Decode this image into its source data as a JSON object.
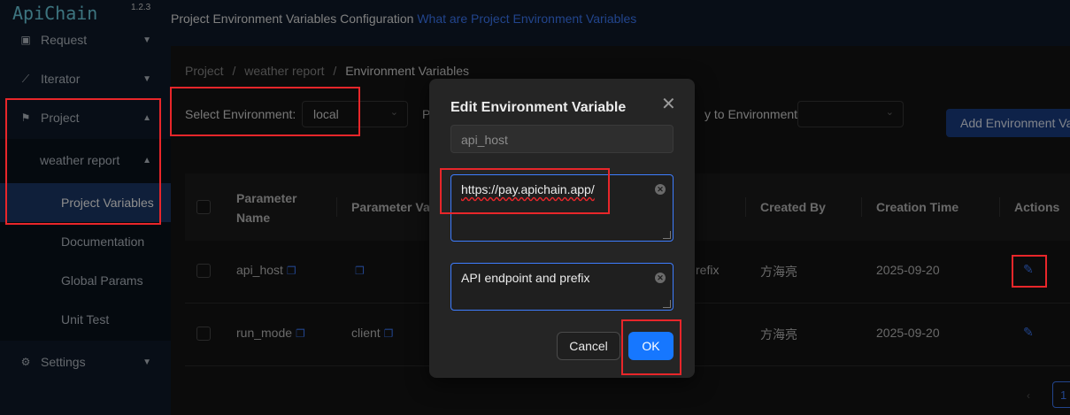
{
  "app": {
    "name": "ApiChain",
    "version": "1.2.3"
  },
  "sidebar": {
    "items": [
      {
        "label": "Request",
        "icon": "request-icon"
      },
      {
        "label": "Iterator",
        "icon": "chart-line-icon"
      },
      {
        "label": "Project",
        "icon": "flag-icon"
      },
      {
        "label": "Settings",
        "icon": "gear-icon"
      }
    ],
    "submenu_title": "weather report",
    "subitems": [
      "Project Variables",
      "Documentation",
      "Global Params",
      "Unit Test"
    ]
  },
  "header": {
    "title": "Project Environment Variables Configuration",
    "link": "What are Project Environment Variables"
  },
  "breadcrumb": {
    "items": [
      "Project",
      "weather report",
      "Environment Variables"
    ],
    "separator": "/"
  },
  "filters": {
    "env_label": "Select Environment:",
    "env_value": "local",
    "p_label_fragment": "P",
    "apply_label": "y to Environment:",
    "add_button": "Add Environment Va"
  },
  "table": {
    "columns": [
      "Parameter Name",
      "Parameter Val",
      "Created By",
      "Creation Time",
      "Actions"
    ],
    "column_name_line1": "Parameter",
    "column_name_line2": "Name",
    "rows": [
      {
        "name": "api_host",
        "value": "",
        "remark_fragment": "refix",
        "created_by": "方海亮",
        "time": "2025-09-20"
      },
      {
        "name": "run_mode",
        "value": "client",
        "remark_fragment": "",
        "created_by": "方海亮",
        "time": "2025-09-20"
      }
    ]
  },
  "modal": {
    "title": "Edit Environment Variable",
    "name_field": "api_host",
    "value_field": "https://pay.apichain.app/",
    "remark_field": "API endpoint and prefix",
    "cancel": "Cancel",
    "ok": "OK"
  },
  "pagination": {
    "current": "1"
  },
  "colors": {
    "accent": "#1677ff",
    "link": "#3e7dff",
    "annotation": "#e8262a"
  }
}
